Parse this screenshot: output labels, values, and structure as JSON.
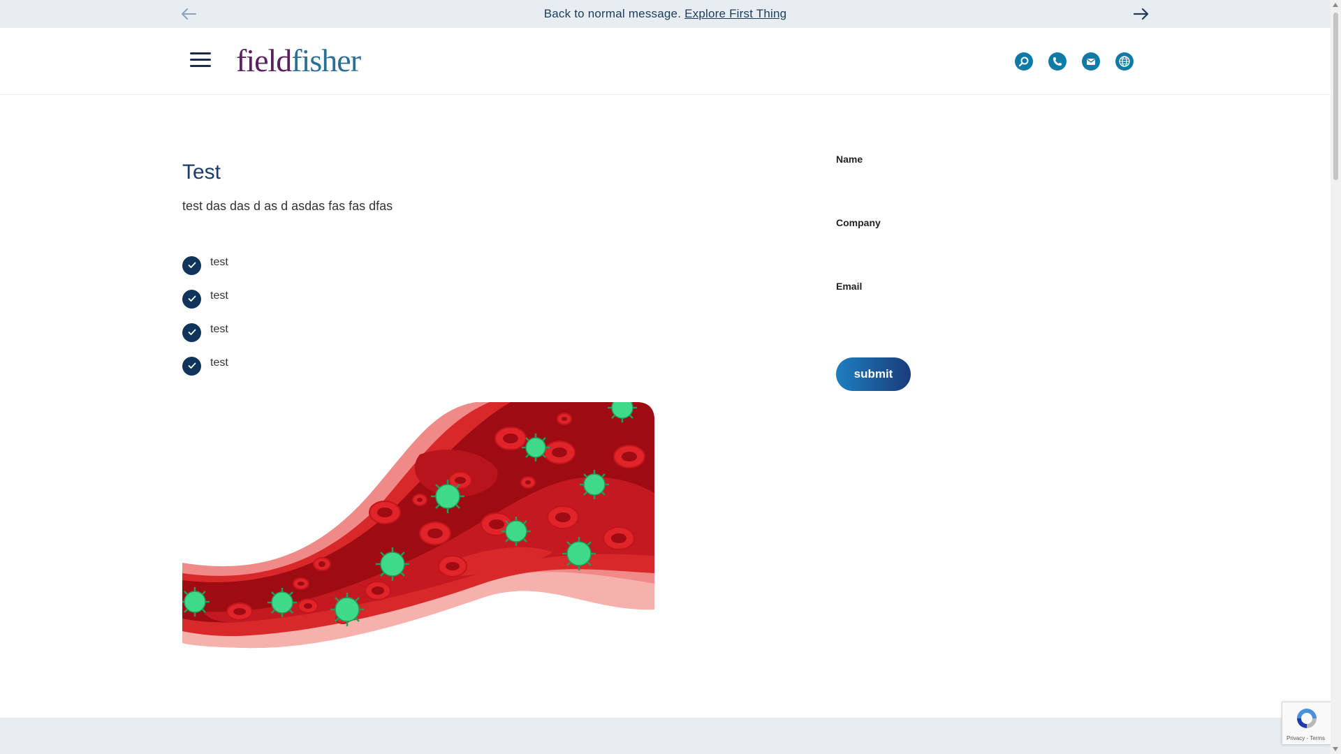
{
  "announcement": {
    "message": "Back to normal message.",
    "link_text": "Explore First Thing",
    "prev_icon": "arrow-left-icon",
    "next_icon": "arrow-right-icon"
  },
  "header": {
    "menu_icon": "hamburger-menu-icon",
    "logo_part1": "field",
    "logo_part2": "fisher",
    "icons": [
      "search-icon",
      "phone-icon",
      "mail-icon",
      "globe-icon"
    ]
  },
  "content": {
    "title": "Test",
    "description": "test das das d as d asdas fas fas dfas",
    "checklist": [
      "test",
      "test",
      "test",
      "test"
    ],
    "hero_image": "blood-vessel-virus-illustration"
  },
  "form": {
    "name_label": "Name",
    "company_label": "Company",
    "email_label": "Email",
    "name_value": "",
    "company_value": "",
    "email_value": "",
    "submit_label": "submit"
  },
  "recaptcha": {
    "text": "Privacy - Terms"
  },
  "colors": {
    "navy": "#10345c",
    "teal": "#0f7aa6",
    "logo_purple": "#5a2060",
    "logo_blue": "#2a6f95",
    "band": "#e8edf2"
  }
}
